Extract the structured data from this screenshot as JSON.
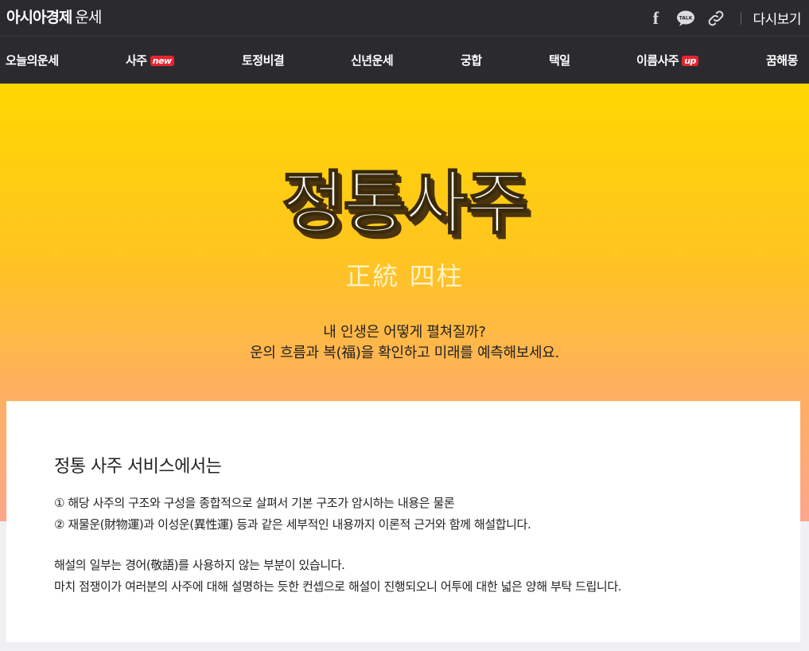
{
  "header": {
    "brand_main": "아시아경제",
    "brand_sub": "운세",
    "replay_label": "다시보기",
    "icons": [
      "facebook-icon",
      "kakaotalk-icon",
      "link-icon"
    ],
    "kakao_label": "TALK"
  },
  "nav": {
    "items": [
      {
        "label": "오늘의운세",
        "badge": ""
      },
      {
        "label": "사주",
        "badge": "new"
      },
      {
        "label": "토정비결",
        "badge": ""
      },
      {
        "label": "신년운세",
        "badge": ""
      },
      {
        "label": "궁합",
        "badge": ""
      },
      {
        "label": "택일",
        "badge": ""
      },
      {
        "label": "이름사주",
        "badge": "up"
      },
      {
        "label": "꿈해몽",
        "badge": ""
      }
    ]
  },
  "hero": {
    "title": "정통사주",
    "hanja": "正統 四柱",
    "desc_line1": "내 인생은 어떻게 펼쳐질까?",
    "desc_line2": "운의 흐름과 복(福)을 확인하고 미래를 예측해보세요."
  },
  "intro": {
    "title": "정통 사주 서비스에서는",
    "line1": "① 해당 사주의 구조와 구성을 종합적으로 살펴서 기본 구조가 암시하는 내용은 물론",
    "line2": "② 재물운(財物運)과 이성운(異性運) 등과 같은 세부적인 내용까지 이론적 근거와 함께 해설합니다.",
    "line3": "해설의 일부는 경어(敬語)를 사용하지 않는 부분이 있습니다.",
    "line4": "마치 점쟁이가 여러분의 사주에 대해 설명하는 듯한 컨셉으로 해설이 진행되오니 어투에 대한 넓은 양해 부탁 드립니다."
  },
  "colors": {
    "header_bg": "#2b2b2f",
    "badge_red": "#e8242f",
    "hero_top": "#ffd700",
    "hero_bottom": "#ffa58a"
  }
}
